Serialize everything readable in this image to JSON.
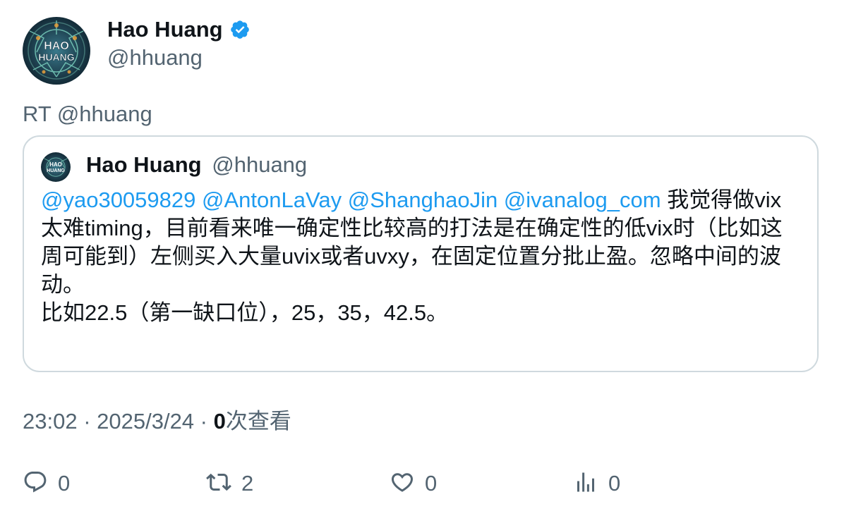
{
  "tweet": {
    "author": {
      "display_name": "Hao Huang",
      "handle": "@hhuang",
      "verified": true,
      "avatar_text_line1": "HAO",
      "avatar_text_line2": "HUANG"
    },
    "retweet_line": "RT @hhuang",
    "quoted": {
      "display_name": "Hao Huang",
      "handle": "@hhuang",
      "mentions": [
        "@yao30059829",
        "@AntonLaVay",
        "@ShanghaoJin",
        "@ivanalog_com"
      ],
      "text_part1": " 我觉得做vix太难timing，目前看来唯一确定性比较高的打法是在确定性的低vix时（比如这周可能到）左侧买入大量uvix或者uvxy，在固定位置分批止盈。忽略中间的波动。",
      "text_part2": "比如22.5（第一缺口位），25，35，42.5。"
    },
    "meta": {
      "time": "23:02",
      "sep1": " · ",
      "date": "2025/3/24",
      "sep2": " · ",
      "views_count": "0",
      "views_label": "次查看"
    },
    "actions": {
      "reply": {
        "icon": "reply-icon",
        "count": "0"
      },
      "retweet": {
        "icon": "retweet-icon",
        "count": "2"
      },
      "like": {
        "icon": "heart-icon",
        "count": "0"
      },
      "analytics": {
        "icon": "analytics-icon",
        "count": "0"
      }
    }
  },
  "colors": {
    "text_primary": "#0f1419",
    "text_secondary": "#536471",
    "link": "#1d9bf0",
    "border": "#cfd9de",
    "verified": "#1d9bf0"
  }
}
